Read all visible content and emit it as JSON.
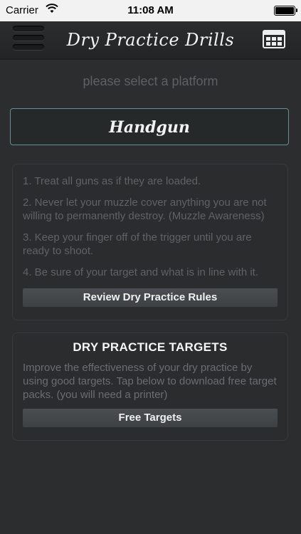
{
  "status_bar": {
    "carrier": "Carrier",
    "time": "11:08 AM"
  },
  "nav": {
    "title": "Dry Practice Drills"
  },
  "main": {
    "subtitle": "please select a platform",
    "platform_button": "Handgun",
    "rules": [
      "1. Treat all guns as if they are loaded.",
      "2. Never let your muzzle cover anything you are not willing to permanently destroy. (Muzzle Awareness)",
      "3. Keep your finger off of the trigger until you are ready to shoot.",
      "4. Be sure of your target and what is in line with it."
    ],
    "review_button": "Review Dry Practice Rules",
    "targets_title": "DRY PRACTICE TARGETS",
    "targets_description": "Improve the effectiveness of your dry practice by using good targets. Tap below to download free target packs. (you will need a printer)",
    "targets_button": "Free Targets"
  },
  "icons": {
    "menu": "hamburger-menu-icon",
    "calendar": "calendar-icon",
    "wifi": "wifi-icon",
    "battery": "battery-icon"
  }
}
